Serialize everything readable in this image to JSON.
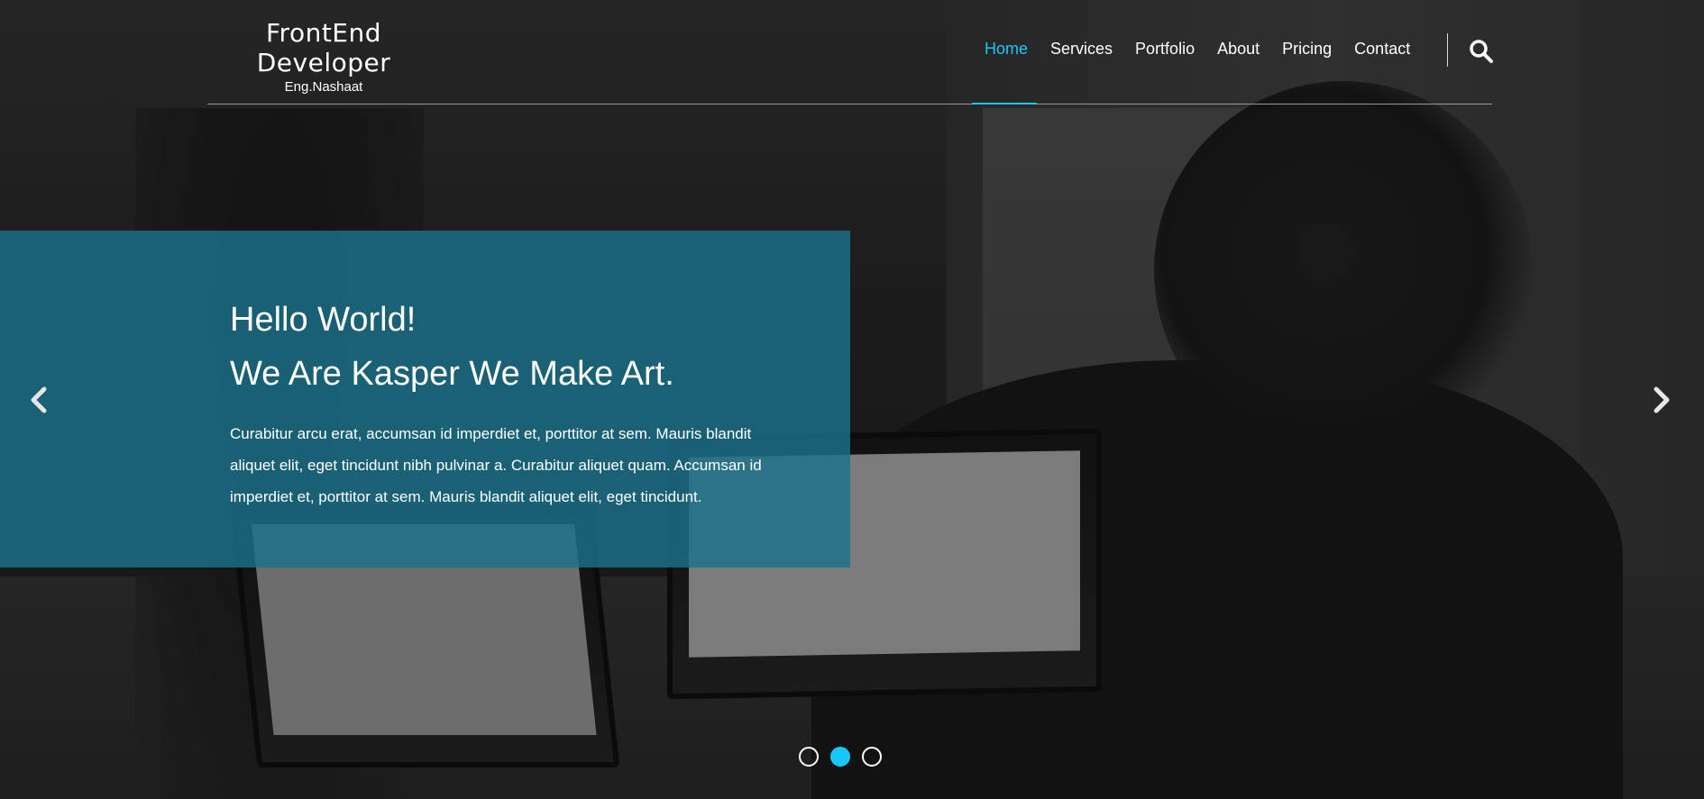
{
  "brand": {
    "title": "FrontEnd Developer",
    "subtitle": "Eng.Nashaat"
  },
  "nav": {
    "items": [
      {
        "label": "Home",
        "active": true
      },
      {
        "label": "Services",
        "active": false
      },
      {
        "label": "Portfolio",
        "active": false
      },
      {
        "label": "About",
        "active": false
      },
      {
        "label": "Pricing",
        "active": false
      },
      {
        "label": "Contact",
        "active": false
      }
    ],
    "search_icon": "search-icon"
  },
  "hero": {
    "heading_line1": "Hello World!",
    "heading_line2": "We Are Kasper We Make Art.",
    "description": "Curabitur arcu erat, accumsan id imperdiet et, porttitor at sem. Mauris blandit aliquet elit, eget tincidunt nibh pulvinar a. Curabitur aliquet quam. Accumsan id imperdiet et, porttitor at sem. Mauris blandit aliquet elit, eget tincidunt."
  },
  "slider": {
    "prev_icon": "chevron-left-icon",
    "next_icon": "chevron-right-icon",
    "slide_count": 3,
    "active_slide": 2
  },
  "colors": {
    "accent": "#19c8fa",
    "content_box": "#1b728a"
  }
}
